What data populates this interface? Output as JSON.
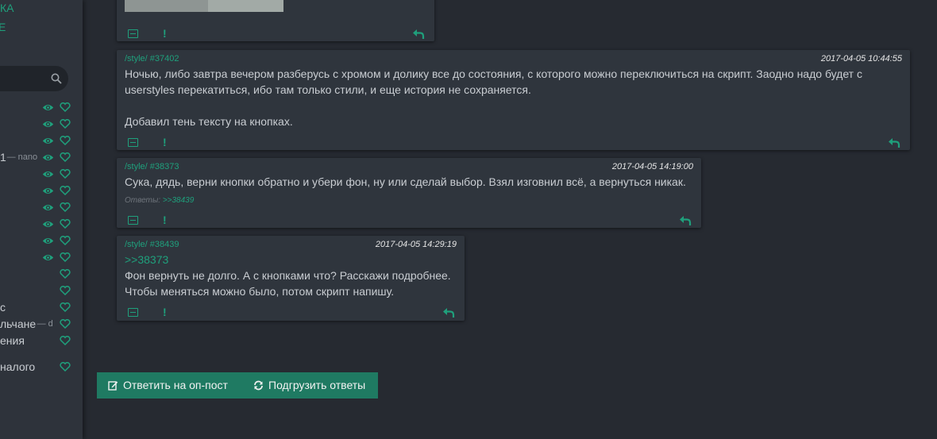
{
  "sidebar": {
    "top_label_1": "КА",
    "top_label_2": "Е",
    "rows": [
      {
        "label": "",
        "sub": "",
        "eye": true
      },
      {
        "label": "",
        "sub": "",
        "eye": true
      },
      {
        "label": "",
        "sub": "",
        "eye": true
      },
      {
        "label": "1",
        "sub": " — nano",
        "eye": true
      },
      {
        "label": "",
        "sub": "",
        "eye": true
      },
      {
        "label": "",
        "sub": "",
        "eye": true
      },
      {
        "label": "",
        "sub": "",
        "eye": true
      },
      {
        "label": "",
        "sub": "",
        "eye": true
      },
      {
        "label": "",
        "sub": "",
        "eye": true
      },
      {
        "label": "",
        "sub": "",
        "eye": true
      },
      {
        "label": "",
        "sub": "",
        "eye": false
      },
      {
        "label": "",
        "sub": "",
        "eye": false
      },
      {
        "label": "с",
        "sub": "",
        "eye": false
      },
      {
        "label": "льчане",
        "sub": " — d",
        "eye": false
      },
      {
        "label": "ения",
        "sub": "",
        "eye": false
      },
      {
        "label": "налого",
        "sub": "",
        "eye": false
      }
    ]
  },
  "posts": [
    {
      "meta": "/style/ #37402",
      "date": "2017-04-05 10:44:55",
      "body_line1": "Ночью, либо завтра вечером разберусь с хромом и долику все до состояния, с которого можно переключиться на скрипт. Заодно надо будет с",
      "body_line2": "userstyles перекатиться, ибо там только стили, и еще история не сохраняется.",
      "body_line3": "Добавил тень тексту на кнопках."
    },
    {
      "meta": "/style/ #38373",
      "date": "2017-04-05 14:19:00",
      "body_line1": "Сука, дядь, верни кнопки обратно и убери фон, ну или сделай выбор. Взял изговнил всё, а вернуться никак.",
      "replies_label": "Ответы:",
      "replies_link": ">>38439"
    },
    {
      "meta": "/style/ #38439",
      "date": "2017-04-05 14:29:19",
      "reflink": ">>38373",
      "body_line1": "Фон вернуть не долго. А с кнопками что? Расскажи подробнее.",
      "body_line2": "Чтобы меняться можно было, потом скрипт напишу."
    }
  ],
  "actions": {
    "reply_op": "Ответить на оп-пост",
    "load_replies": "Подгрузить ответы"
  },
  "colors": {
    "accent": "#1fa07c",
    "button_bg": "#1f7a62",
    "post_bg": "#2f353d",
    "page_bg": "#262a31"
  }
}
